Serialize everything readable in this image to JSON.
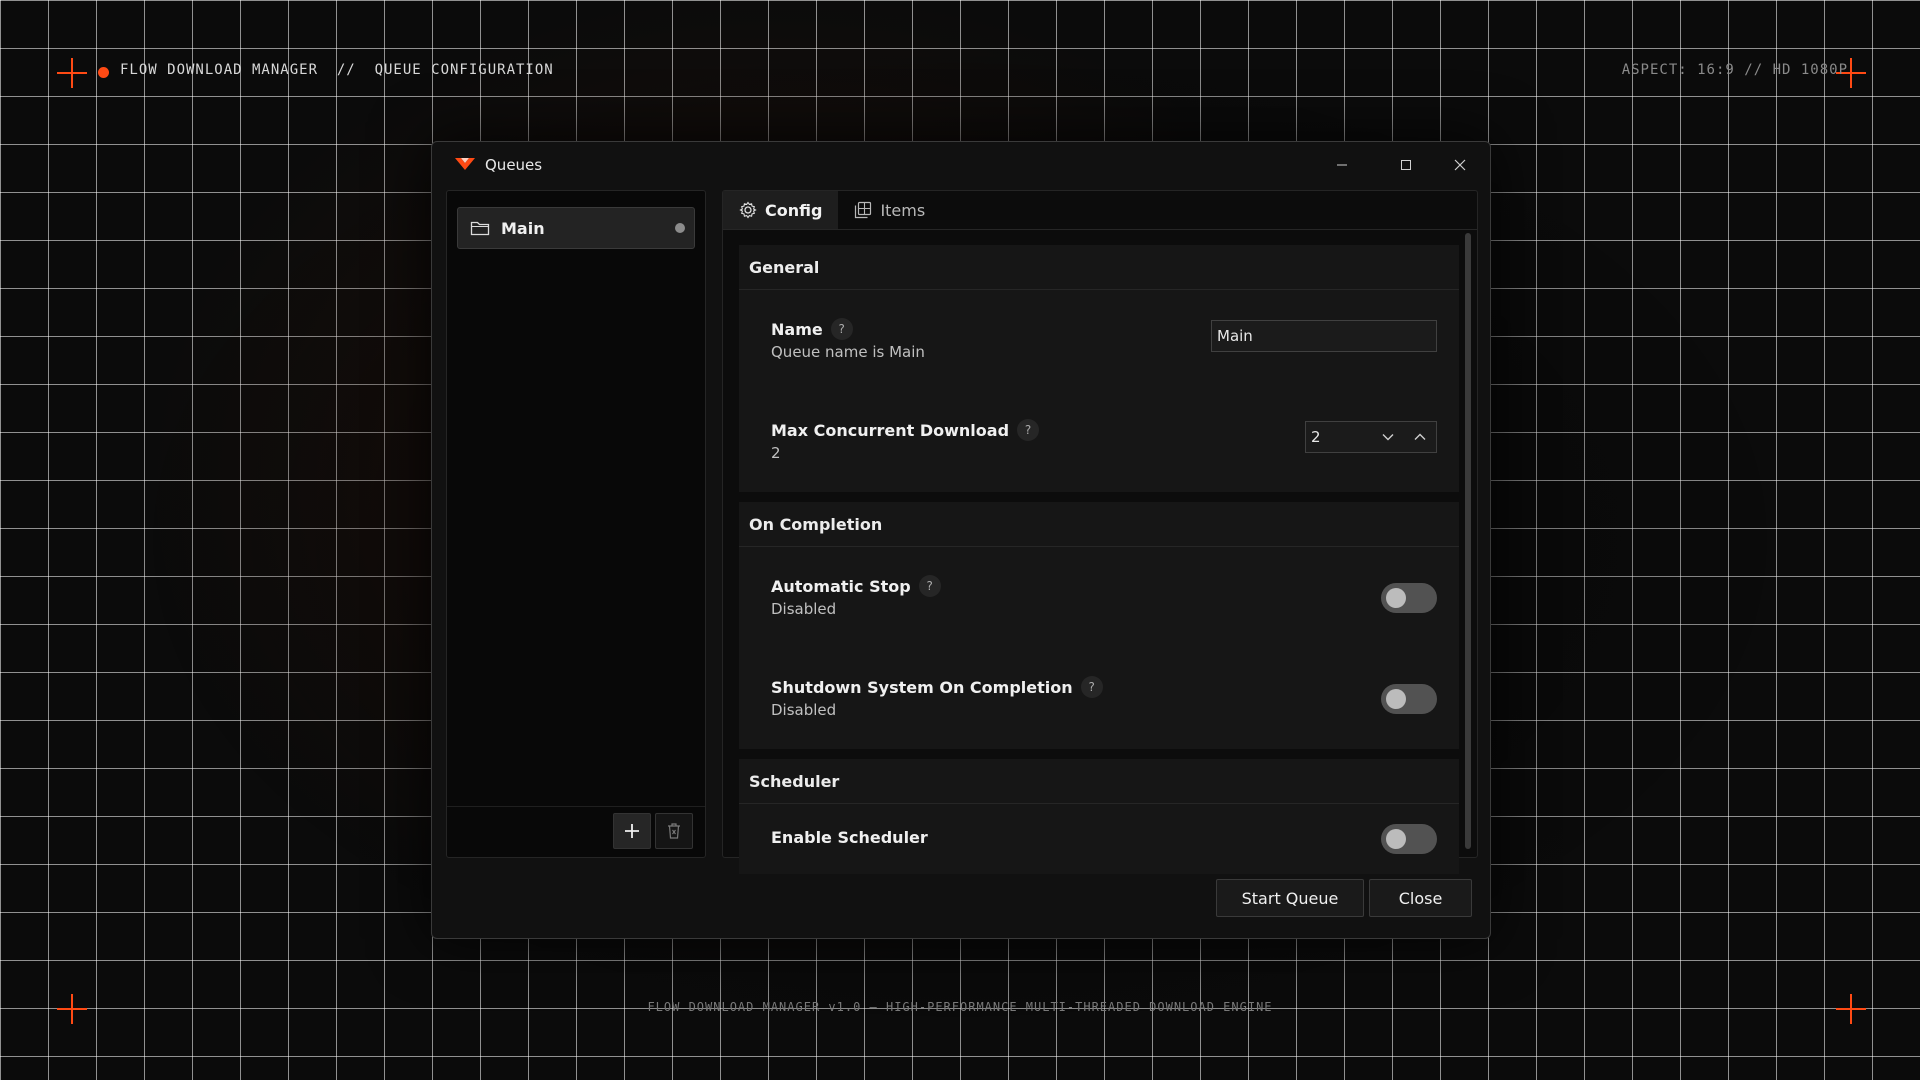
{
  "hud": {
    "top_left": "FLOW DOWNLOAD MANAGER  //  QUEUE CONFIGURATION",
    "top_right": "ASPECT: 16:9 // HD 1080P",
    "footer": "FLOW DOWNLOAD MANAGER v1.0 — HIGH-PERFORMANCE MULTI-THREADED DOWNLOAD ENGINE",
    "accent_color": "#ff4a14"
  },
  "window": {
    "title": "Queues",
    "controls": {
      "minimize": "–",
      "maximize": "☐",
      "close": "✕"
    }
  },
  "sidebar": {
    "items": [
      {
        "label": "Main",
        "icon": "folder-icon"
      }
    ],
    "add_label": "+",
    "delete_icon": "trash-icon"
  },
  "tabs": [
    {
      "label": "Config",
      "icon": "gear-icon",
      "active": true
    },
    {
      "label": "Items",
      "icon": "items-icon",
      "active": false
    }
  ],
  "sections": {
    "general": {
      "title": "General",
      "name": {
        "label": "Name",
        "help": "?",
        "desc": "Queue name is Main",
        "value": "Main"
      },
      "max_concurrent": {
        "label": "Max Concurrent Download",
        "help": "?",
        "desc": "2",
        "value": "2"
      }
    },
    "on_completion": {
      "title": "On Completion",
      "automatic_stop": {
        "label": "Automatic Stop",
        "help": "?",
        "desc": "Disabled",
        "enabled": false
      },
      "shutdown": {
        "label": "Shutdown System On Completion",
        "help": "?",
        "desc": "Disabled",
        "enabled": false
      }
    },
    "scheduler": {
      "title": "Scheduler",
      "enable": {
        "label": "Enable Scheduler",
        "enabled": false
      }
    }
  },
  "footer": {
    "start_label": "Start Queue",
    "close_label": "Close"
  }
}
